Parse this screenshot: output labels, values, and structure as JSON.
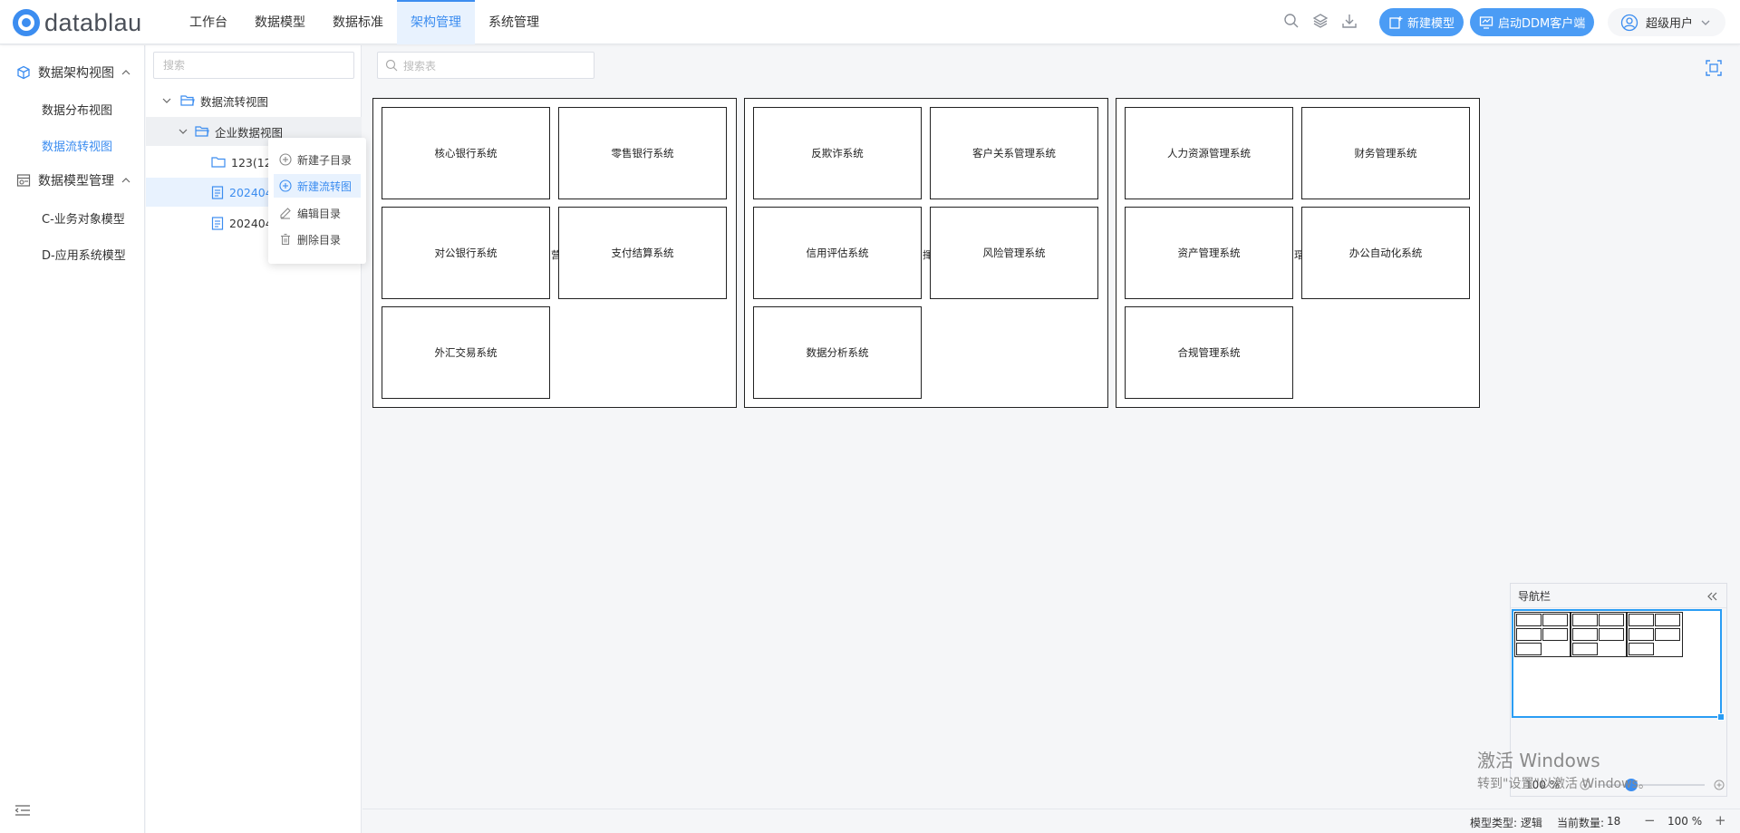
{
  "app": {
    "brand": "datablau"
  },
  "nav": {
    "items": [
      "工作台",
      "数据模型",
      "数据标准",
      "架构管理",
      "系统管理"
    ],
    "active_index": 3
  },
  "header": {
    "new_model": "新建模型",
    "ddm_client": "启动DDM客户端",
    "user": "超级用户"
  },
  "sidebar": {
    "group1": "数据架构视图",
    "group1_items": [
      "数据分布视图",
      "数据流转视图"
    ],
    "group2": "数据模型管理",
    "group2_items": [
      "C-业务对象模型",
      "D-应用系统模型"
    ]
  },
  "tree": {
    "search_placeholder": "搜索",
    "root": "数据流转视图",
    "enterprise": "企业数据视图",
    "children": [
      "123(12",
      "202404",
      "202404"
    ]
  },
  "context_menu": {
    "items": [
      "新建子目录",
      "新建流转图",
      "编辑目录",
      "删除目录"
    ],
    "active_index": 1
  },
  "canvas": {
    "search_placeholder": "搜索表",
    "groups": [
      {
        "nodes": [
          "核心银行系统",
          "零售银行系统",
          "对公银行系统",
          "支付结算系统",
          "外汇交易系统"
        ],
        "stub": "营"
      },
      {
        "nodes": [
          "反欺诈系统",
          "客户关系管理系统",
          "信用评估系统",
          "风险管理系统",
          "数据分析系统"
        ],
        "stub": "揮"
      },
      {
        "nodes": [
          "人力资源管理系统",
          "财务管理系统",
          "资产管理系统",
          "办公自动化系统",
          "合规管理系统"
        ],
        "stub": "瑁"
      }
    ]
  },
  "navpanel": {
    "title": "导航栏",
    "zoom": "100 %",
    "zoom_level": 1.0
  },
  "watermark": {
    "line1": "激活 Windows",
    "line2": "转到\"设置\"以激活 Windows。"
  },
  "status": {
    "model_type_label": "模型类型: 逻辑",
    "count_label": "当前数量:",
    "count": "18",
    "zoom": "100 %",
    "minus": "−",
    "plus": "+"
  },
  "colors": {
    "accent": "#3c8df0",
    "accent_light": "#e8f2fe",
    "nav_highlight": "#2a9df4"
  }
}
